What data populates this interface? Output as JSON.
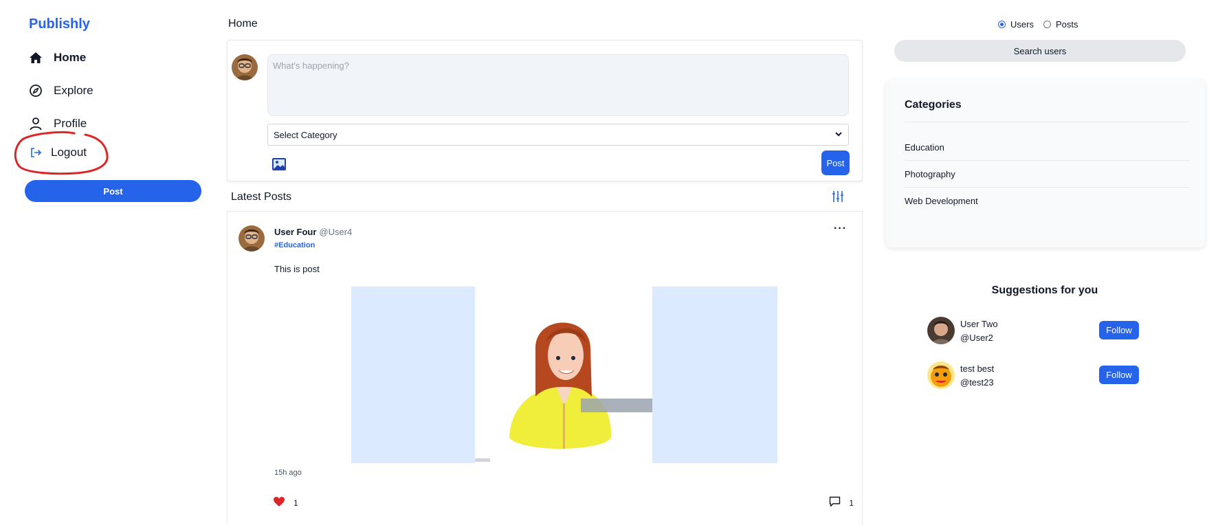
{
  "brand": "Publishly",
  "nav": {
    "home": "Home",
    "explore": "Explore",
    "profile": "Profile",
    "logout": "Logout",
    "post_button": "Post"
  },
  "main": {
    "title": "Home",
    "composer": {
      "placeholder": "What's happening?",
      "category_select": "Select Category",
      "post_button": "Post"
    },
    "latest_title": "Latest Posts",
    "post": {
      "author": "User Four",
      "handle": "@User4",
      "tag": "#Education",
      "text": "This is post",
      "time": "15h ago",
      "likes": "1",
      "comments": "1",
      "more": "···"
    }
  },
  "right": {
    "search_mode": {
      "users": "Users",
      "posts": "Posts",
      "selected": "Users"
    },
    "search_placeholder": "Search users",
    "categories": {
      "title": "Categories",
      "items": [
        "Education",
        "Photography",
        "Web Development"
      ]
    },
    "suggestions": {
      "title": "Suggestions for you",
      "follow_label": "Follow",
      "users": [
        {
          "name": "User Two",
          "handle": "@User2"
        },
        {
          "name": "test best",
          "handle": "@test23"
        }
      ]
    }
  },
  "colors": {
    "accent": "#2563eb",
    "annotation": "#dc2626",
    "like": "#dc2626"
  }
}
